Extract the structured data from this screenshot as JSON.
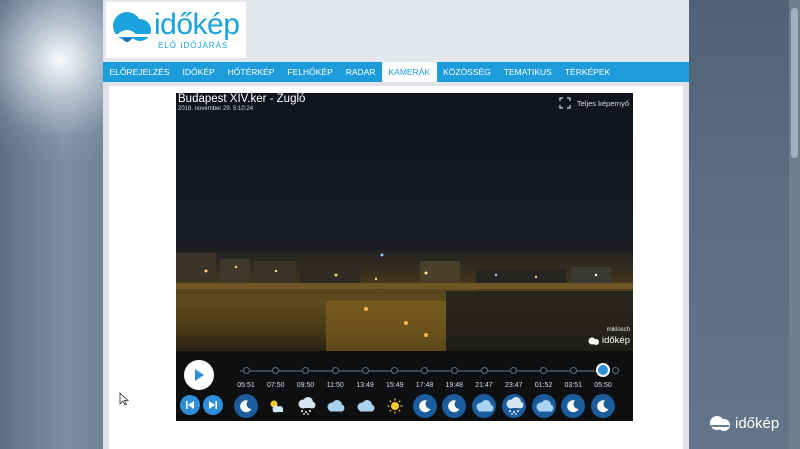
{
  "brand": {
    "logo_text": "időkép",
    "tagline": "ELŐ IDŐJÁRÁS",
    "accent_color": "#1d9cdc"
  },
  "nav": {
    "items": [
      {
        "label": "ELŐREJELZÉS",
        "active": false
      },
      {
        "label": "IDŐKÉP",
        "active": false
      },
      {
        "label": "HŐTÉRKÉP",
        "active": false
      },
      {
        "label": "FELHŐKÉP",
        "active": false
      },
      {
        "label": "RADAR",
        "active": false
      },
      {
        "label": "KAMERÁK",
        "active": true
      },
      {
        "label": "KÖZÖSSÉG",
        "active": false
      },
      {
        "label": "TEMATIKUS",
        "active": false
      },
      {
        "label": "TÉRKÉPEK",
        "active": false
      }
    ]
  },
  "camera": {
    "title": "Budapest XIV.ker - Zugló",
    "datetime": "2018. november 29. 5:10:24",
    "fullscreen_label": "Teljes képernyő",
    "uploader": "miklosch",
    "watermark": "időkép"
  },
  "timeline": {
    "entries": [
      {
        "time": "05:51",
        "weather": "moon-icon",
        "bubble": true
      },
      {
        "time": "07:50",
        "weather": "sun-cloud-icon",
        "bubble": false
      },
      {
        "time": "09:50",
        "weather": "snow-cloud-icon",
        "bubble": false
      },
      {
        "time": "11:50",
        "weather": "cloud-icon",
        "bubble": false
      },
      {
        "time": "13:49",
        "weather": "cloud-icon",
        "bubble": false
      },
      {
        "time": "15:49",
        "weather": "sun-icon",
        "bubble": false
      },
      {
        "time": "17:48",
        "weather": "moon-icon",
        "bubble": true
      },
      {
        "time": "19:48",
        "weather": "moon-icon",
        "bubble": true
      },
      {
        "time": "21:47",
        "weather": "cloud-icon",
        "bubble": true
      },
      {
        "time": "23:47",
        "weather": "snow-cloud-icon",
        "bubble": true
      },
      {
        "time": "01:52",
        "weather": "cloud-icon",
        "bubble": true
      },
      {
        "time": "03:51",
        "weather": "moon-icon",
        "bubble": true
      },
      {
        "time": "05:50",
        "weather": "moon-icon",
        "bubble": true
      }
    ],
    "current_index": 12
  },
  "corner_watermark": "időkép"
}
